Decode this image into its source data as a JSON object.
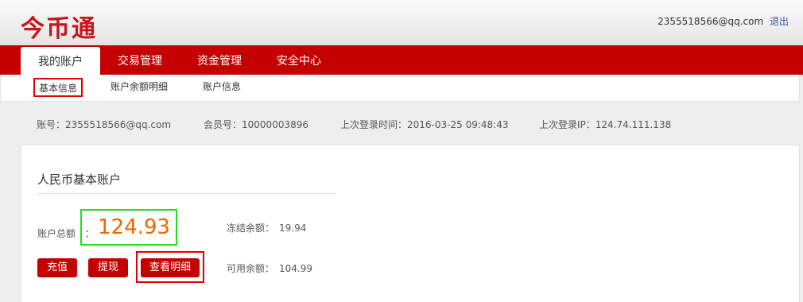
{
  "header": {
    "logo": "今币通",
    "user_email": "2355518566@qq.com",
    "logout_label": "退出"
  },
  "nav": {
    "tabs": [
      {
        "label": "我的账户",
        "active": true
      },
      {
        "label": "交易管理"
      },
      {
        "label": "资金管理"
      },
      {
        "label": "安全中心"
      }
    ]
  },
  "subnav": {
    "items": [
      {
        "label": "基本信息",
        "active": true
      },
      {
        "label": "账户余额明细"
      },
      {
        "label": "账户信息"
      }
    ]
  },
  "account_info": {
    "account_label": "账号：",
    "account_value": "2355518566@qq.com",
    "member_label": "会员号：",
    "member_value": "10000003896",
    "last_login_time_label": "上次登录时间：",
    "last_login_time_value": "2016-03-25 09:48:43",
    "last_login_ip_label": "上次登录IP：",
    "last_login_ip_value": "124.74.111.138"
  },
  "panel": {
    "title": "人民币基本账户",
    "total_label": "账户总额",
    "total_sep": "：",
    "total_value": "124.93",
    "frozen_label": "冻结余额：",
    "frozen_value": "19.94",
    "available_label": "可用余额：",
    "available_value": "104.99",
    "buttons": {
      "recharge": "充值",
      "withdraw": "提现",
      "view_detail": "查看明细"
    }
  },
  "colors": {
    "brand_red": "#c50000",
    "total_value": "#ee6600",
    "highlight_green": "#22dd22",
    "highlight_red": "#e00000"
  }
}
